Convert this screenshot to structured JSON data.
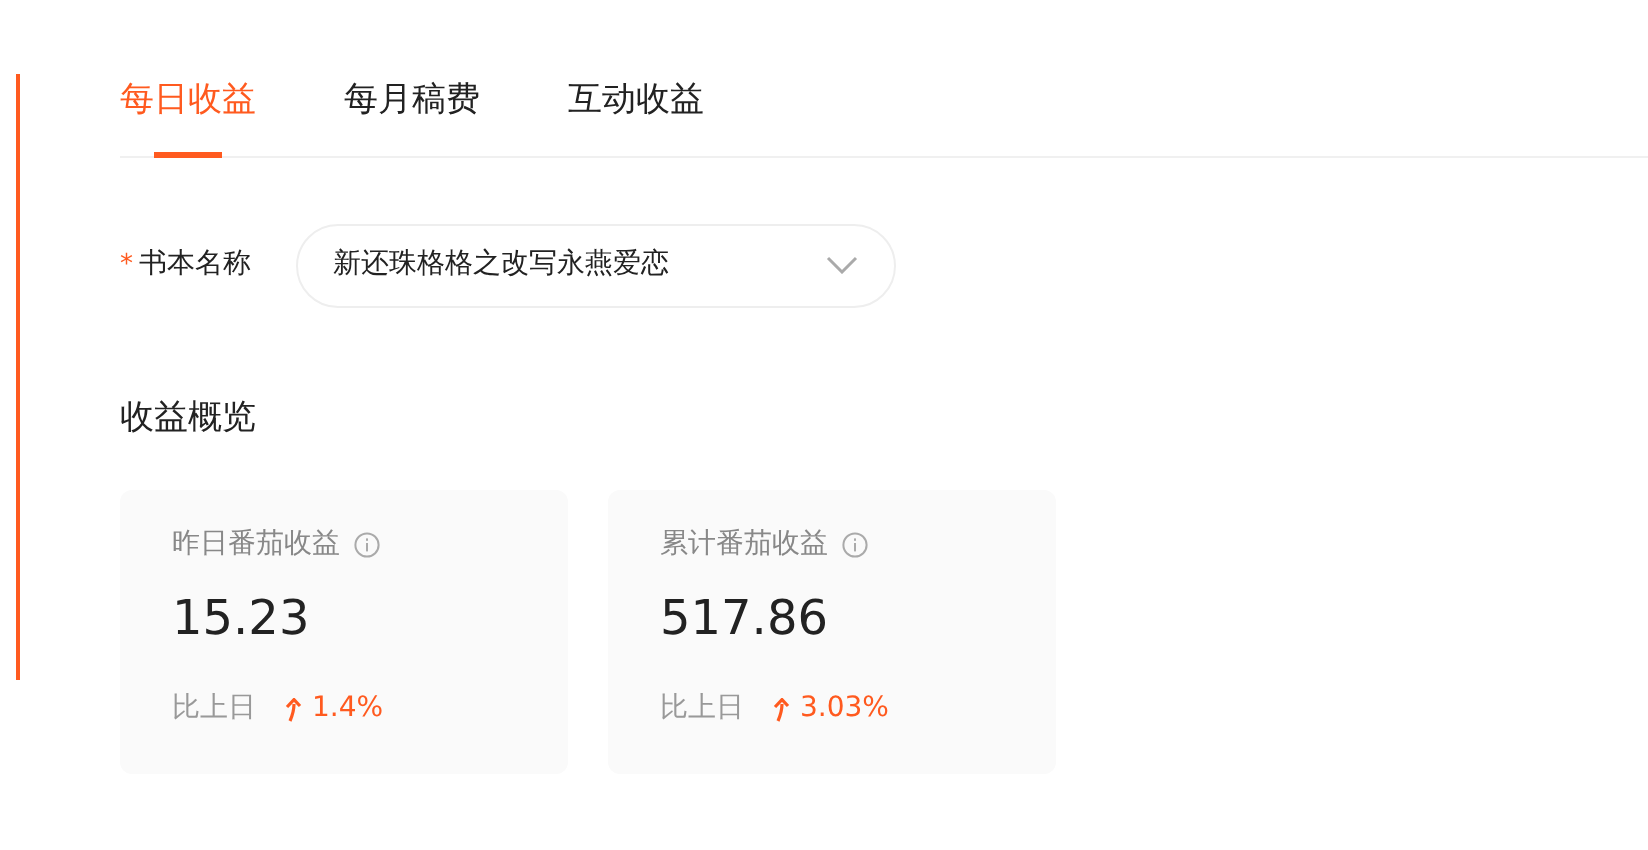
{
  "tabs": [
    {
      "label": "每日收益",
      "selected": true
    },
    {
      "label": "每月稿费",
      "selected": false
    },
    {
      "label": "互动收益",
      "selected": false
    }
  ],
  "book_field": {
    "required_mark": "*",
    "label": "书本名称",
    "value": "新还珠格格之改写永燕爱恋"
  },
  "overview": {
    "title": "收益概览",
    "cards": [
      {
        "title": "昨日番茄收益",
        "value": "15.23",
        "compare_label": "比上日",
        "rising": true,
        "change": "1.4%"
      },
      {
        "title": "累计番茄收益",
        "value": "517.86",
        "compare_label": "比上日",
        "rising": true,
        "change": "3.03%"
      }
    ]
  }
}
